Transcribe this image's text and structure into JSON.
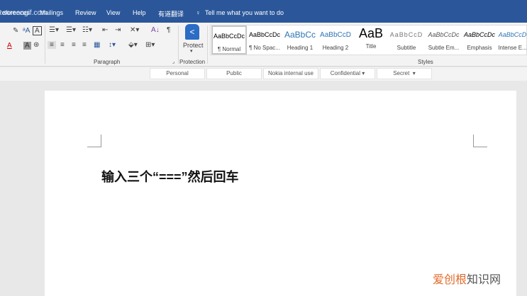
{
  "watermark": "screengif.com",
  "tabs": [
    "References",
    "Mailings",
    "Review",
    "View",
    "Help",
    "有道翻译"
  ],
  "tell_me": "Tell me what you want to do",
  "groups": {
    "paragraph": "Paragraph",
    "protection": "Protection",
    "styles": "Styles"
  },
  "protect_label": "Protect",
  "styles": [
    {
      "sample": "AaBbCcDc",
      "label": "¶ Normal"
    },
    {
      "sample": "AaBbCcDc",
      "label": "¶ No Spac..."
    },
    {
      "sample": "AaBbCc",
      "label": "Heading 1"
    },
    {
      "sample": "AaBbCcD",
      "label": "Heading 2"
    },
    {
      "sample": "AaB",
      "label": "Title"
    },
    {
      "sample": "AaBbCcD",
      "label": "Subtitle"
    },
    {
      "sample": "AaBbCcDc",
      "label": "Subtle Em..."
    },
    {
      "sample": "AaBbCcDc",
      "label": "Emphasis"
    },
    {
      "sample": "AaBbCcD",
      "label": "Intense E..."
    }
  ],
  "tags": [
    "Personal",
    "Public",
    "Nokia internal use",
    "Confidential",
    "Secret"
  ],
  "document_text": "输入三个“===”然后回车",
  "brand": {
    "part1": "爱创根",
    "part2": "知识网",
    "color1": "#e06a2a",
    "color2": "#555555"
  },
  "accent": "#2b579a"
}
